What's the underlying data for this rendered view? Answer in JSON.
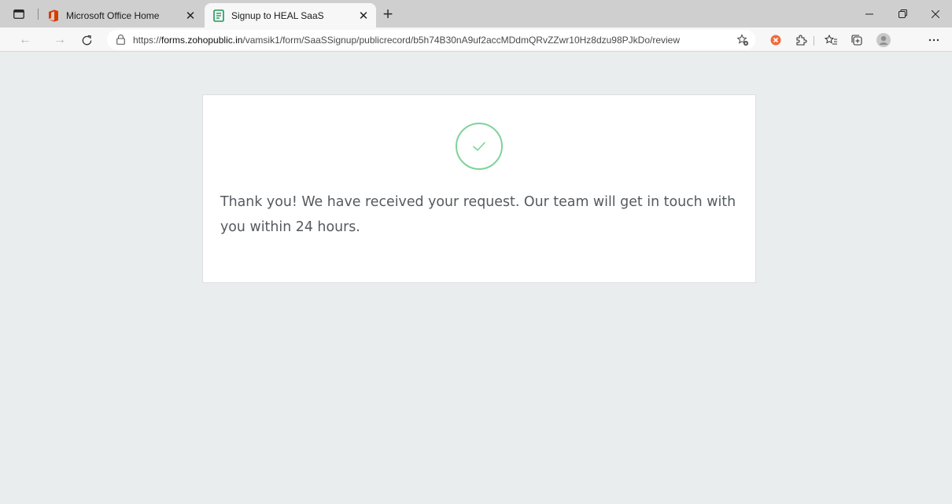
{
  "browser": {
    "tabs": [
      {
        "title": "Microsoft Office Home",
        "active": false,
        "icon": "office-icon"
      },
      {
        "title": "Signup to HEAL SaaS",
        "active": true,
        "icon": "form-icon"
      }
    ],
    "url_domain": "forms.zohopublic.in",
    "url_prefix": "https://",
    "url_path": "/vamsik1/form/SaaSSignup/publicrecord/b5h74B30nA9uf2accMDdmQRvZZwr10Hz8dzu98PJkDo/review",
    "colors": {
      "office_red": "#d83b01",
      "form_green": "#1e9a57",
      "extension_orange": "#f26b3a"
    }
  },
  "page": {
    "confirmation_message": "Thank you! We have received your request. Our team will get in touch with you within 24 hours.",
    "success_icon": "check-circle-icon",
    "colors": {
      "background": "#e9edee",
      "card": "#ffffff",
      "check": "#7dd39a",
      "text": "#555a5e"
    }
  }
}
